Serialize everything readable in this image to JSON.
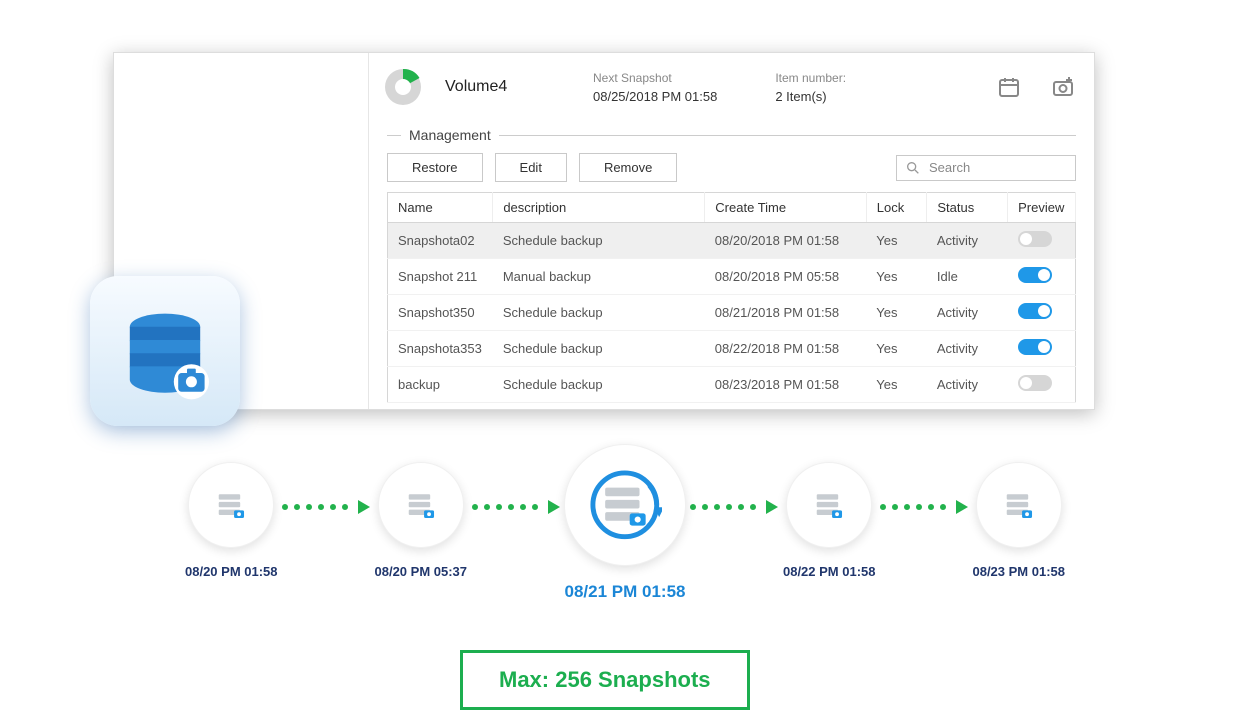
{
  "header": {
    "volume_name": "Volume4",
    "next_snapshot_label": "Next Snapshot",
    "next_snapshot_value": "08/25/2018 PM 01:58",
    "item_number_label": "Item number:",
    "item_number_value": "2 Item(s)"
  },
  "panel": {
    "title": "Management",
    "restore_label": "Restore",
    "edit_label": "Edit",
    "remove_label": "Remove",
    "search_placeholder": "Search"
  },
  "columns": {
    "name": "Name",
    "description": "description",
    "create_time": "Create Time",
    "lock": "Lock",
    "status": "Status",
    "preview": "Preview"
  },
  "rows": [
    {
      "name": "Snapshota02",
      "description": "Schedule backup",
      "create_time": "08/20/2018 PM 01:58",
      "lock": "Yes",
      "status": "Activity",
      "status_class": "",
      "preview_on": false,
      "selected": true
    },
    {
      "name": "Snapshot 211",
      "description": "Manual backup",
      "create_time": "08/20/2018 PM 05:58",
      "lock": "Yes",
      "status": "Idle",
      "status_class": "status-idle",
      "preview_on": true,
      "selected": false
    },
    {
      "name": "Snapshot350",
      "description": "Schedule backup",
      "create_time": "08/21/2018 PM 01:58",
      "lock": "Yes",
      "status": "Activity",
      "status_class": "",
      "preview_on": true,
      "selected": false
    },
    {
      "name": "Snapshota353",
      "description": "Schedule backup",
      "create_time": "08/22/2018 PM 01:58",
      "lock": "Yes",
      "status": "Activity",
      "status_class": "",
      "preview_on": true,
      "selected": false
    },
    {
      "name": "backup",
      "description": "Schedule backup",
      "create_time": "08/23/2018 PM 01:58",
      "lock": "Yes",
      "status": "Activity",
      "status_class": "",
      "preview_on": false,
      "selected": false
    }
  ],
  "timeline": [
    {
      "label": "08/20 PM 01:58",
      "active": false
    },
    {
      "label": "08/20 PM 05:37",
      "active": false
    },
    {
      "label": "08/21 PM 01:58",
      "active": true
    },
    {
      "label": "08/22 PM 01:58",
      "active": false
    },
    {
      "label": "08/23 PM 01:58",
      "active": false
    }
  ],
  "footer": {
    "max_label": "Max: 256 Snapshots"
  },
  "colors": {
    "accent_blue": "#1f98e8",
    "accent_green": "#22b24c",
    "label_navy": "#20366c"
  }
}
